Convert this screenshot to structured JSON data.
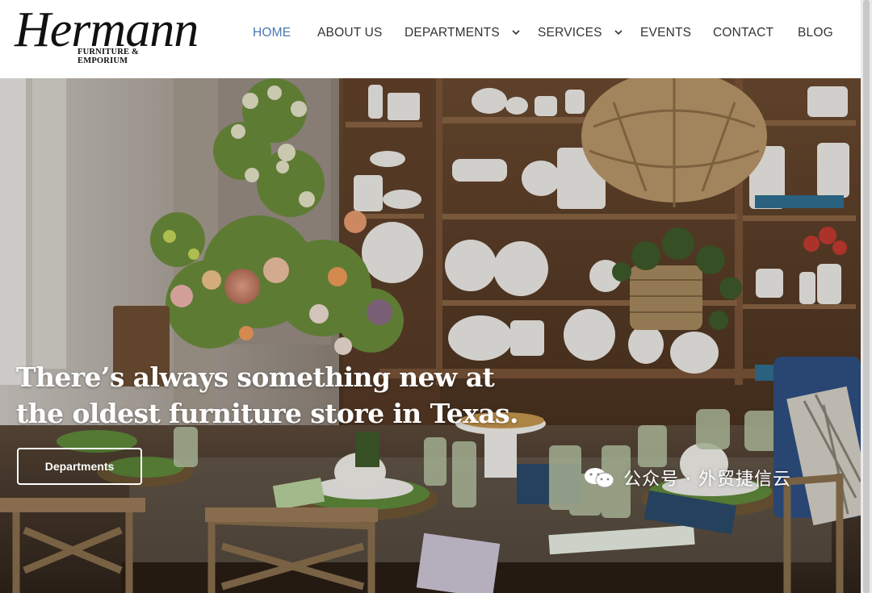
{
  "brand": {
    "name_script": "Hermann",
    "tagline": "FURNITURE & EMPORIUM"
  },
  "nav": {
    "items": [
      {
        "label": "HOME",
        "active": true
      },
      {
        "label": "ABOUT US"
      },
      {
        "label": "DEPARTMENTS",
        "has_dropdown": true
      },
      {
        "label": "SERVICES",
        "has_dropdown": true
      },
      {
        "label": "EVENTS"
      },
      {
        "label": "CONTACT"
      },
      {
        "label": "BLOG"
      }
    ]
  },
  "hero": {
    "headline_line1": "There’s always something new at",
    "headline_line2": "the oldest furniture store in Texas.",
    "cta_label": "Departments"
  },
  "watermark": {
    "text": "公众号 · 外贸捷信云"
  },
  "colors": {
    "nav_active": "#4a78b0",
    "nav_text": "#333333",
    "hero_text": "#ffffff"
  }
}
